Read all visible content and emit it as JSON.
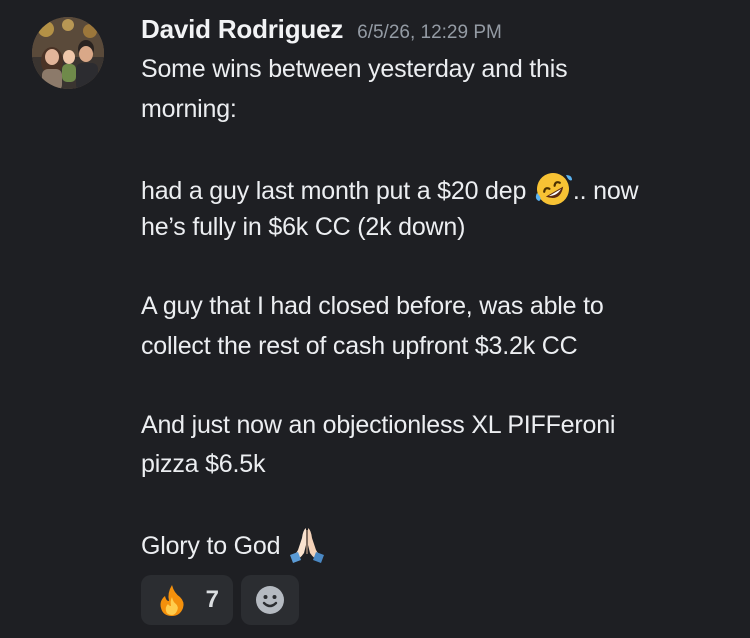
{
  "message": {
    "author": "David Rodriguez",
    "timestamp": "6/5/26, 12:29 PM",
    "lines": {
      "l1": "Some wins between yesterday and this",
      "l2": "morning:",
      "l3a": "had a guy last month put a $20 dep ",
      "l3b": ".. now",
      "l4": "he’s fully in $6k CC (2k down)",
      "l5": "A guy that I had closed before, was able to",
      "l6": "collect the rest of cash upfront $3.2k CC",
      "l7": "And just now an objectionless XL PIFFeroni",
      "l8": "pizza $6.5k",
      "l9": "Glory to God "
    },
    "inline_emojis": [
      "rolling-on-floor-laughing-emoji",
      "folded-hands-emoji"
    ]
  },
  "reactions": [
    {
      "emoji": "fire-emoji",
      "count": "7"
    },
    {
      "emoji": "add-reaction-smiley-icon"
    }
  ],
  "colors": {
    "background": "#1e1f23",
    "text": "#eceef1",
    "timestamp": "#949ba4",
    "reaction_bg": "#2b2d31"
  }
}
